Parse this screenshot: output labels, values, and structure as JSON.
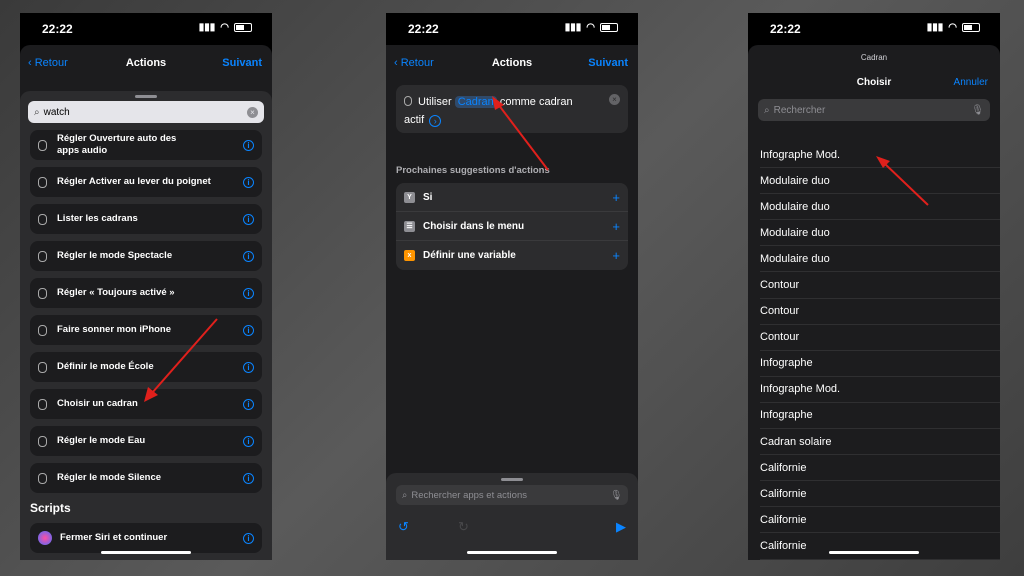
{
  "status": {
    "time": "22:22"
  },
  "screen1": {
    "back_label": "Retour",
    "title": "Actions",
    "next_label": "Suivant",
    "search_value": "watch",
    "actions": [
      {
        "label": "Régler Ouverture auto des apps audio"
      },
      {
        "label": "Régler Activer au lever du poignet"
      },
      {
        "label": "Lister les cadrans"
      },
      {
        "label": "Régler le mode Spectacle"
      },
      {
        "label": "Régler « Toujours activé »"
      },
      {
        "label": "Faire sonner mon iPhone"
      },
      {
        "label": "Définir le mode École"
      },
      {
        "label": "Choisir un cadran"
      },
      {
        "label": "Régler le mode Eau"
      },
      {
        "label": "Régler le mode Silence"
      }
    ],
    "section_label": "Scripts",
    "script_item": "Fermer Siri et continuer"
  },
  "screen2": {
    "back_label": "Retour",
    "title": "Actions",
    "next_label": "Suivant",
    "action_prefix": "Utiliser",
    "action_token": "Cadran",
    "action_suffix": "comme cadran",
    "action_line2": "actif",
    "suggestions_header": "Prochaines suggestions d'actions",
    "suggestions": [
      {
        "label": "Si",
        "color": "#8e8e93"
      },
      {
        "label": "Choisir dans le menu",
        "color": "#8e8e93"
      },
      {
        "label": "Définir une variable",
        "color": "#ff9500"
      }
    ],
    "search_placeholder": "Rechercher apps et actions"
  },
  "screen3": {
    "subtitle": "Cadran",
    "title": "Choisir",
    "cancel_label": "Annuler",
    "search_placeholder": "Rechercher",
    "options": [
      "Infographe Mod.",
      "Modulaire duo",
      "Modulaire duo",
      "Modulaire duo",
      "Modulaire duo",
      "Contour",
      "Contour",
      "Contour",
      "Infographe",
      "Infographe Mod.",
      "Infographe",
      "Cadran solaire",
      "Californie",
      "Californie",
      "Californie",
      "Californie"
    ]
  },
  "colors": {
    "accent": "#0a84ff",
    "annotation": "#e0201c"
  }
}
